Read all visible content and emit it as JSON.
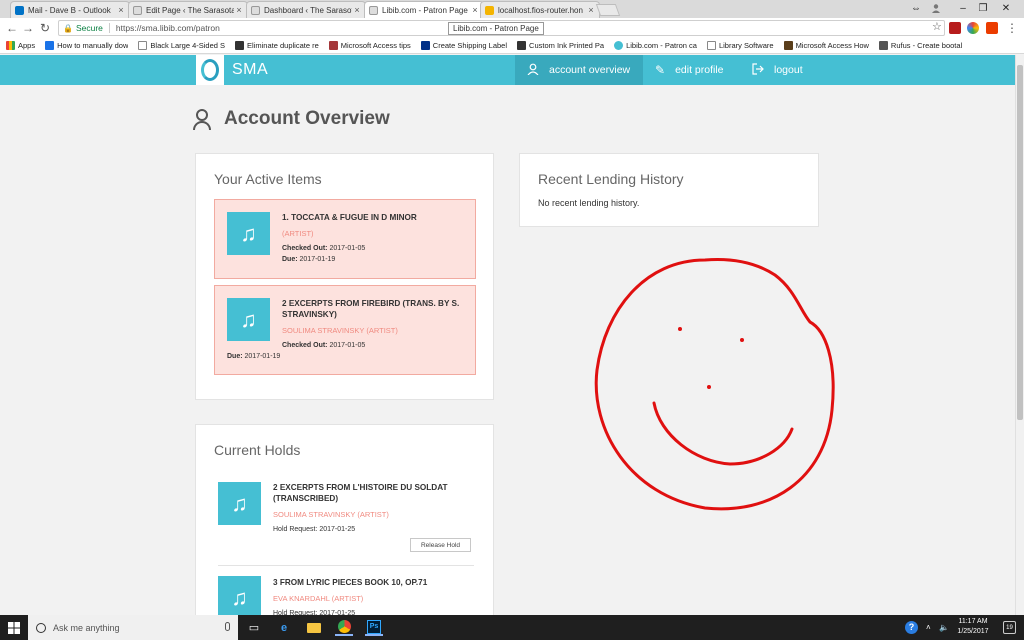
{
  "browser": {
    "tabs": [
      {
        "label": "Mail - Dave B - Outlook",
        "favicon_color": "#0072c6"
      },
      {
        "label": "Edit Page ‹ The Sarasota",
        "favicon_color": "#888888"
      },
      {
        "label": "Dashboard ‹ The Sarasot",
        "favicon_color": "#888888"
      },
      {
        "label": "Libib.com - Patron Page",
        "favicon_color": "#888888"
      },
      {
        "label": "localhost.fios-router.hon",
        "favicon_color": "#f4b400"
      }
    ],
    "active_tab_index": 3,
    "close_glyph": "×",
    "secure_label": "Secure",
    "url": "https://sma.libib.com/patron",
    "tooltip": "Libib.com - Patron Page",
    "bookmarks": [
      {
        "label": "Apps",
        "color": "#ea4335"
      },
      {
        "label": "How to manually dow",
        "color": "#1a73e8"
      },
      {
        "label": "Black Large 4-Sided S",
        "color": "#888888"
      },
      {
        "label": "Eliminate duplicate re",
        "color": "#333333"
      },
      {
        "label": "Microsoft Access tips",
        "color": "#a4373a"
      },
      {
        "label": "Create Shipping Label",
        "color": "#003087"
      },
      {
        "label": "Custom Ink Printed Pa",
        "color": "#333333"
      },
      {
        "label": "Libib.com - Patron ca",
        "color": "#45bfd3"
      },
      {
        "label": "Library Software",
        "color": "#888888"
      },
      {
        "label": "Microsoft Access How",
        "color": "#5a3e1b"
      },
      {
        "label": "Rufus - Create bootal",
        "color": "#555555"
      }
    ]
  },
  "site": {
    "brand": "SMA",
    "accent_color": "#45bfd3",
    "nav": [
      {
        "label": "account overview",
        "icon": "user-icon",
        "active": true
      },
      {
        "label": "edit profile",
        "icon": "pencil-icon",
        "active": false
      },
      {
        "label": "logout",
        "icon": "logout-icon",
        "active": false
      }
    ]
  },
  "page": {
    "title": "Account Overview"
  },
  "active_items": {
    "heading": "Your Active Items",
    "items": [
      {
        "title": "1. Toccata & Fugue in D Minor",
        "artist": "(Artist)",
        "checked_out_label": "Checked Out:",
        "checked_out": "2017-01-05",
        "due_label": "Due:",
        "due": "2017-01-19"
      },
      {
        "title": "2 Excerpts from Firebird (Trans. by S. Stravinsky)",
        "artist": "Soulima Stravinsky (Artist)",
        "checked_out_label": "Checked Out:",
        "checked_out": "2017-01-05",
        "due_label": "Due:",
        "due": "2017-01-19"
      }
    ]
  },
  "lending_history": {
    "heading": "Recent Lending History",
    "empty_text": "No recent lending history."
  },
  "holds": {
    "heading": "Current Holds",
    "items": [
      {
        "title": "2 Excerpts from L'Histoire du Soldat (Transcribed)",
        "artist": "Soulima Stravinsky (Artist)",
        "request_label": "Hold Request:",
        "request_date": "2017-01-25",
        "button": "Release Hold"
      },
      {
        "title": "3 From Lyric Pieces Book 10, Op.71",
        "artist": "Eva Knardahl (Artist)",
        "request_label": "Hold Request:",
        "request_date": "2017-01-25"
      }
    ]
  },
  "drawing": {
    "color": "#e01010"
  },
  "taskbar": {
    "search_placeholder": "Ask me anything",
    "time": "11:17 AM",
    "date": "1/25/2017",
    "notifications": "19"
  }
}
